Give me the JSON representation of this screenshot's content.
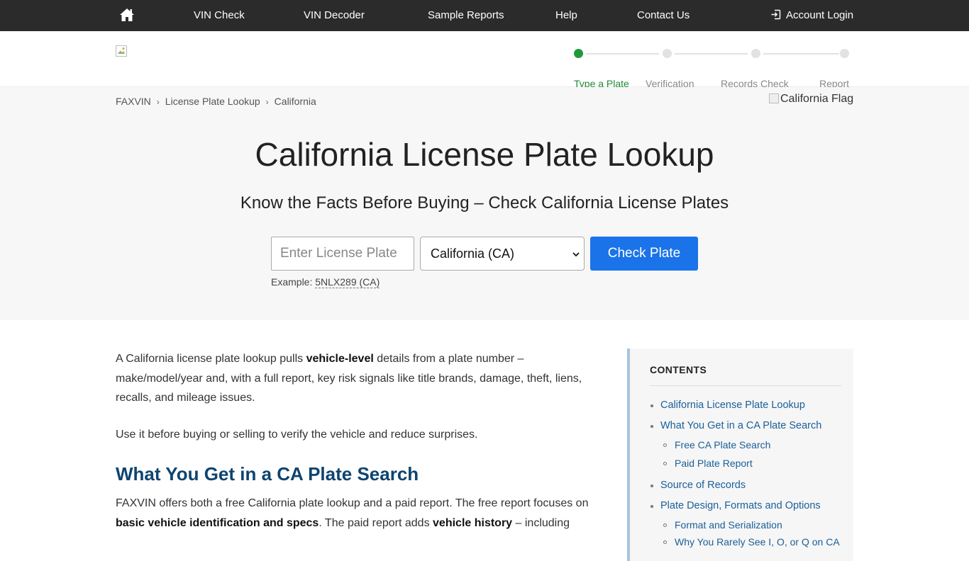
{
  "topnav": {
    "home_icon": "home-icon",
    "items": [
      "VIN Check",
      "VIN Decoder",
      "Sample Reports",
      "Help",
      "Contact Us"
    ],
    "login_label": "Account Login",
    "login_icon": "sign-in-icon"
  },
  "steps": {
    "labels": [
      "Type a Plate",
      "Verification",
      "Records Check",
      "Report"
    ],
    "active_index": 0,
    "active_color": "#1e9a3a"
  },
  "breadcrumb": [
    "FAXVIN",
    "License Plate Lookup",
    "California"
  ],
  "flag_alt": "California Flag",
  "hero": {
    "title": "California License Plate Lookup",
    "subtitle": "Know the Facts Before Buying – Check California License Plates",
    "plate_placeholder": "Enter License Plate",
    "plate_value": "",
    "state_selected": "California (CA)",
    "button_label": "Check Plate",
    "button_color": "#1a73e8",
    "example_prefix": "Example: ",
    "example_value": "5NLX289 (CA)"
  },
  "content": {
    "p1_a": "A California license plate lookup pulls ",
    "p1_b": "vehicle-level",
    "p1_c": " details from a plate number – make/model/year and, with a full report, key risk signals like title brands, damage, theft, liens, recalls, and mileage issues.",
    "p2": "Use it before buying or selling to verify the vehicle and reduce surprises.",
    "h3": "What You Get in a CA Plate Search",
    "p3_a": "FAXVIN offers both a free California plate lookup and a paid report. The free report focuses on ",
    "p3_b": "basic vehicle identification and specs",
    "p3_c": ". The paid report adds ",
    "p3_d": "vehicle history",
    "p3_e": " – including"
  },
  "toc": {
    "title": "CONTENTS",
    "items": [
      "California License Plate Lookup",
      "What You Get in a CA Plate Search",
      "Free CA Plate Search",
      "Paid Plate Report",
      "Source of Records",
      "Plate Design, Formats and Options",
      "Format and Serialization",
      "Why You Rarely See I, O, or Q on CA"
    ]
  }
}
